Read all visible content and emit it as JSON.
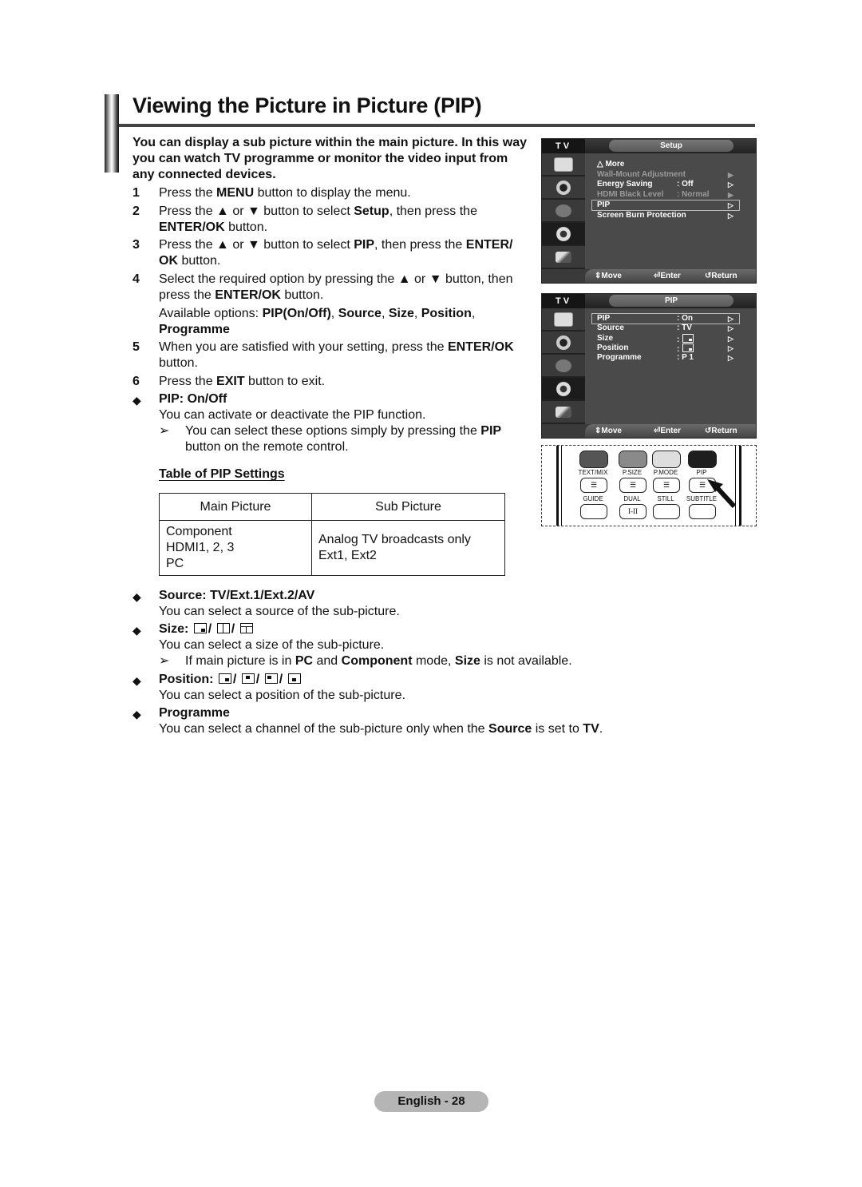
{
  "page": {
    "title": "Viewing the Picture in Picture (PIP)",
    "intro": "You can display a sub picture within the main picture. In this way you can watch TV programme or monitor the video input from any connected devices.",
    "footer": "English - 28"
  },
  "steps": [
    {
      "num": "1",
      "parts": [
        [
          "Press the ",
          false
        ],
        [
          "MENU",
          true
        ],
        [
          " button to display the menu.",
          false
        ]
      ]
    },
    {
      "num": "2",
      "parts": [
        [
          "Press the ▲ or ▼ button to select ",
          false
        ],
        [
          "Setup",
          true
        ],
        [
          ", then press the ",
          false
        ],
        [
          "ENTER/OK",
          true
        ],
        [
          " button.",
          false
        ]
      ]
    },
    {
      "num": "3",
      "parts": [
        [
          "Press the ▲ or ▼ button to select ",
          false
        ],
        [
          "PIP",
          true
        ],
        [
          ", then press the ",
          false
        ],
        [
          "ENTER/ OK",
          true
        ],
        [
          " button.",
          false
        ]
      ]
    },
    {
      "num": "4",
      "parts": [
        [
          "Select the required option by pressing the ▲ or ▼ button, then press the ",
          false
        ],
        [
          "ENTER/OK",
          true
        ],
        [
          " button.",
          false
        ]
      ]
    },
    {
      "num": "5",
      "parts": [
        [
          "When you are satisfied with your setting, press the ",
          false
        ],
        [
          "ENTER/OK",
          true
        ],
        [
          " button.",
          false
        ]
      ]
    },
    {
      "num": "6",
      "parts": [
        [
          "Press the ",
          false
        ],
        [
          "EXIT",
          true
        ],
        [
          " button to exit.",
          false
        ]
      ]
    }
  ],
  "available_options": {
    "prefix": "Available options: ",
    "options": [
      "PIP(On/Off)",
      "Source",
      "Size",
      "Position",
      "Programme"
    ]
  },
  "sections": {
    "pip": {
      "bullet": "◆",
      "label": "PIP",
      "value": ": On/Off",
      "desc": "You can activate or deactivate the PIP function.",
      "note_arrow": "➢",
      "note_parts": [
        [
          "You can select these options simply by pressing the ",
          false
        ],
        [
          "PIP",
          true
        ],
        [
          " button on the remote control.",
          false
        ]
      ]
    },
    "table": {
      "title": "Table of PIP Settings",
      "headers": [
        "Main Picture",
        "Sub Picture"
      ],
      "main_rows": [
        "Component",
        "HDMI1, 2, 3",
        "PC"
      ],
      "sub_rows": [
        "Analog TV broadcasts only",
        "Ext1, Ext2"
      ]
    },
    "source": {
      "bullet": "◆",
      "label": "Source",
      "value": ": TV/Ext.1/Ext.2/AV",
      "desc": "You can select a source of the sub-picture."
    },
    "size": {
      "bullet": "◆",
      "label": "Size: ",
      "icons": [
        "size-small-icon",
        "size-double-icon",
        "size-double-wide-icon"
      ],
      "separator": "/",
      "desc": "You can select a size of the sub-picture.",
      "note_arrow": "➢",
      "note_parts": [
        [
          "If main picture is in ",
          false
        ],
        [
          "PC",
          true
        ],
        [
          " and ",
          false
        ],
        [
          "Component",
          true
        ],
        [
          " mode, ",
          false
        ],
        [
          "Size",
          true
        ],
        [
          " is not available.",
          false
        ]
      ]
    },
    "position": {
      "bullet": "◆",
      "label": "Position: ",
      "icons": [
        "position-bottom-right-icon",
        "position-top-left-icon",
        "position-top-right-icon",
        "position-bottom-left-icon"
      ],
      "separator": "/",
      "desc": "You can select a position of the sub-picture."
    },
    "programme": {
      "bullet": "◆",
      "label": "Programme",
      "desc_parts": [
        [
          "You can select a channel of the sub-picture only when the ",
          false
        ],
        [
          "Source",
          true
        ],
        [
          " is set to ",
          false
        ],
        [
          "TV",
          true
        ],
        [
          ".",
          false
        ]
      ]
    }
  },
  "osd_setup": {
    "tab": "TV",
    "header": "Setup",
    "items": [
      {
        "label": "△  More",
        "value": "",
        "arrow": "",
        "dim": false
      },
      {
        "label": "Wall-Mount Adjustment",
        "value": "",
        "arrow": "▶",
        "dim": true
      },
      {
        "label": "Energy Saving",
        "value": ": Off",
        "arrow": "▷",
        "dim": false
      },
      {
        "label": "HDMI Black Level",
        "value": ": Normal",
        "arrow": "▶",
        "dim": true
      },
      {
        "label": "PIP",
        "value": "",
        "arrow": "▷",
        "dim": false,
        "highlighted": true
      },
      {
        "label": "Screen Burn Protection",
        "value": "",
        "arrow": "▷",
        "dim": false
      }
    ],
    "footer": {
      "move": "Move",
      "enter": "Enter",
      "return": "Return"
    }
  },
  "osd_pip": {
    "tab": "TV",
    "header": "PIP",
    "items": [
      {
        "label": "PIP",
        "value": ": On",
        "arrow": "▷",
        "highlighted": true
      },
      {
        "label": "Source",
        "value": ": TV",
        "arrow": "▷"
      },
      {
        "label": "Size",
        "value": ":",
        "arrow": "▷",
        "icon": "size-small-icon"
      },
      {
        "label": "Position",
        "value": ":",
        "arrow": "▷",
        "icon": "position-bottom-right-icon"
      },
      {
        "label": "Programme",
        "value": ": P   1",
        "arrow": "▷"
      }
    ],
    "footer": {
      "move": "Move",
      "enter": "Enter",
      "return": "Return"
    }
  },
  "remote": {
    "color_buttons": [
      "#555555",
      "#8a8a8a",
      "#dedede",
      "#1e1e1e"
    ],
    "top_labels": [
      "TEXT/MIX",
      "P.SIZE",
      "P.MODE",
      "PIP"
    ],
    "bottom_labels": [
      "GUIDE",
      "DUAL",
      "STILL",
      "SUBTITLE"
    ],
    "dual_key": "I-II"
  }
}
